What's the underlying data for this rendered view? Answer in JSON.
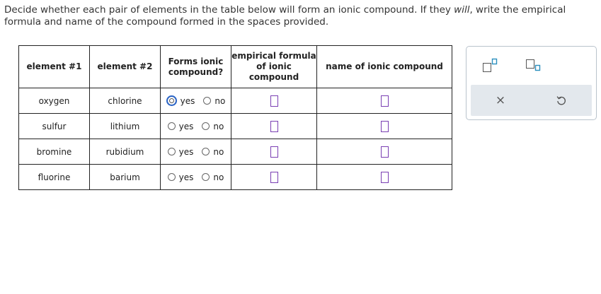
{
  "instructions": {
    "part1": "Decide whether each pair of elements in the table below will form an ionic compound. If they ",
    "emphasis": "will",
    "part2": ", write the empirical formula and name of the compound formed in the spaces provided."
  },
  "table": {
    "headers": {
      "element1": "element #1",
      "element2": "element #2",
      "forms_ionic": "Forms ionic compound?",
      "formula": "empirical formula of ionic compound",
      "name": "name of ionic compound"
    },
    "radio_labels": {
      "yes": "yes",
      "no": "no"
    },
    "rows": [
      {
        "element1": "oxygen",
        "element2": "chlorine"
      },
      {
        "element1": "sulfur",
        "element2": "lithium"
      },
      {
        "element1": "bromine",
        "element2": "rubidium"
      },
      {
        "element1": "fluorine",
        "element2": "barium"
      }
    ]
  },
  "tools": {
    "superscript_icon": "superscript-box-icon",
    "subscript_icon": "subscript-box-icon",
    "clear_icon": "close-icon",
    "undo_icon": "undo-icon",
    "clear_label": "×"
  },
  "colors": {
    "answer_box_border": "#7a3fb3",
    "focus_ring": "#2a64c6",
    "tool_accent": "#2a8fbd",
    "tool_bar_bg": "#e3e8ed"
  }
}
